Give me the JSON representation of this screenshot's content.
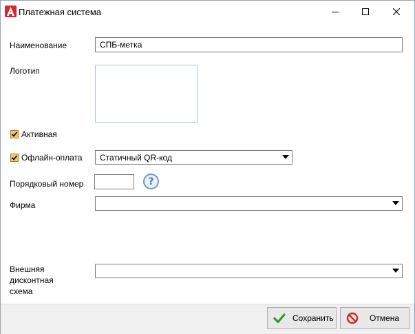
{
  "window": {
    "title": "Платежная система",
    "icon": "app-logo-a-icon",
    "minimize_icon": "minimize-icon",
    "maximize_icon": "maximize-icon",
    "close_icon": "close-icon"
  },
  "form": {
    "name_label": "Наименование",
    "name_value": "СПБ-метка",
    "logo_label": "Логотип",
    "active_label": "Активная",
    "active_checked": true,
    "offline_label": "Офлайн-оплата",
    "offline_checked": true,
    "offline_type_value": "Статичный QR-код",
    "order_label": "Порядковый номер",
    "order_value": "",
    "help_icon": "help-question-icon",
    "firm_label": "Фирма",
    "firm_value": "",
    "discount_label_line1": "Внешняя",
    "discount_label_line2": "дисконтная",
    "discount_label_line3": "схема",
    "discount_value": ""
  },
  "footer": {
    "save_label": "Сохранить",
    "save_icon": "checkmark-icon",
    "cancel_label": "Отмена",
    "cancel_icon": "cancel-icon"
  },
  "colors": {
    "checkbox_fill": "#f2c46b",
    "check_green": "#2e9a2e",
    "cancel_red": "#d42020",
    "app_icon_red": "#d8282f"
  }
}
